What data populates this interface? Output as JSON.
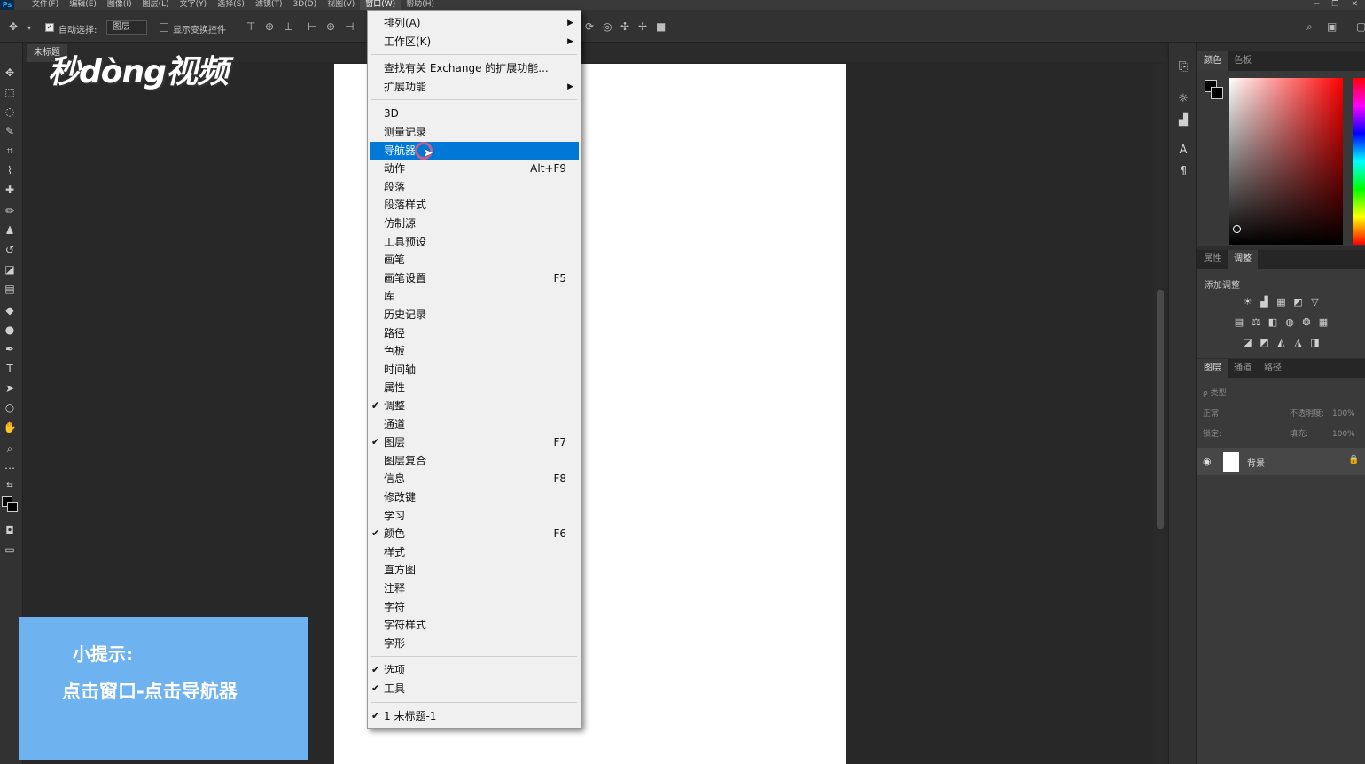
{
  "menubar": {
    "logo": "Ps",
    "items": [
      "文件(F)",
      "编辑(E)",
      "图像(I)",
      "图层(L)",
      "文字(Y)",
      "选择(S)",
      "滤镜(T)",
      "3D(D)",
      "视图(V)",
      "窗口(W)",
      "帮助(H)"
    ],
    "active_index": 9
  },
  "options": {
    "auto_select_label": "自动选择:",
    "auto_select_value": "图层",
    "show_transform_label": "显示变换控件"
  },
  "document": {
    "tab_label": "未标题"
  },
  "watermark": "秒dòng视频",
  "tip": {
    "title": "小提示:",
    "body": "点击窗口-点击导航器"
  },
  "window_menu": {
    "items": [
      {
        "label": "排列(A)",
        "submenu": true
      },
      {
        "label": "工作区(K)",
        "submenu": true
      },
      {
        "sep": true
      },
      {
        "label": "查找有关 Exchange 的扩展功能..."
      },
      {
        "label": "扩展功能",
        "submenu": true
      },
      {
        "sep": true
      },
      {
        "label": "3D"
      },
      {
        "label": "测量记录"
      },
      {
        "label": "导航器",
        "highlighted": true
      },
      {
        "label": "动作",
        "shortcut": "Alt+F9"
      },
      {
        "label": "段落"
      },
      {
        "label": "段落样式"
      },
      {
        "label": "仿制源"
      },
      {
        "label": "工具预设"
      },
      {
        "label": "画笔"
      },
      {
        "label": "画笔设置",
        "shortcut": "F5"
      },
      {
        "label": "库"
      },
      {
        "label": "历史记录"
      },
      {
        "label": "路径"
      },
      {
        "label": "色板"
      },
      {
        "label": "时间轴"
      },
      {
        "label": "属性"
      },
      {
        "label": "调整",
        "checked": true
      },
      {
        "label": "通道"
      },
      {
        "label": "图层",
        "checked": true,
        "shortcut": "F7"
      },
      {
        "label": "图层复合"
      },
      {
        "label": "信息",
        "shortcut": "F8"
      },
      {
        "label": "修改键"
      },
      {
        "label": "学习"
      },
      {
        "label": "颜色",
        "checked": true,
        "shortcut": "F6"
      },
      {
        "label": "样式"
      },
      {
        "label": "直方图"
      },
      {
        "label": "注释"
      },
      {
        "label": "字符"
      },
      {
        "label": "字符样式"
      },
      {
        "label": "字形"
      },
      {
        "sep": true
      },
      {
        "label": "选项",
        "checked": true
      },
      {
        "label": "工具",
        "checked": true
      },
      {
        "sep": true
      },
      {
        "label": "1 未标题-1",
        "checked": true
      }
    ]
  },
  "panels": {
    "color_tabs": [
      "颜色",
      "色板"
    ],
    "adjust_tabs": [
      "属性",
      "调整"
    ],
    "adjust_add_label": "添加调整",
    "layer_tabs": [
      "图层",
      "通道",
      "路径"
    ],
    "layer_filter": "ρ 类型",
    "blend_mode": "正常",
    "opacity_label": "不透明度:",
    "opacity_value": "100%",
    "lock_label": "锁定:",
    "fill_label": "填充:",
    "fill_value": "100%",
    "layer_name": "背景"
  },
  "colors": {
    "highlight": "#0078d7",
    "tip_bg": "#6fb2f0"
  }
}
